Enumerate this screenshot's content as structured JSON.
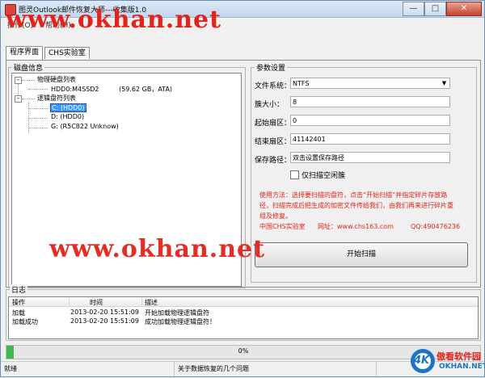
{
  "window": {
    "title": "图灵Outlook邮件恢复大师---收集版1.0"
  },
  "menubar": {
    "items": [
      "操作(O)",
      "帮助(H)"
    ]
  },
  "watermark": {
    "site": "www.okhan.net"
  },
  "tabs": [
    {
      "label": "程序界面",
      "active": true
    },
    {
      "label": "CHS实验室",
      "active": false
    }
  ],
  "disk_info": {
    "group_label": "磁盘信息",
    "physical_root": "物理硬盘列表",
    "physical_disk": {
      "name": "HDD0:M4SSD2",
      "detail": "(59.62 GB，ATA)"
    },
    "logical_root": "逻辑盘符列表",
    "logical_drives": [
      "C: (HDD0)",
      "D: (HDD0)",
      "G: (R5C822 Unknow)"
    ]
  },
  "params": {
    "group_label": "参数设置",
    "filesystem_label": "文件系统：",
    "filesystem_value": "NTFS",
    "cluster_label": "簇大小：",
    "cluster_value": "8",
    "start_label": "起始扇区：",
    "start_value": "0",
    "end_label": "结束扇区：",
    "end_value": "41142401",
    "save_label": "保存路径：",
    "save_value": "双击设置保存路径",
    "scan_free_label": "仅扫描空闲簇",
    "usage_line1": "使用方法：选择要扫描的盘符，点击“开始扫描”并指定碎片存放路",
    "usage_line2": "径，扫描完成后把生成的加密文件传给我们，由我们再来进行碎片重",
    "usage_line3": "组及修复。",
    "lab_name": "中国CHS实验室",
    "website": "网址：www.chs163.com",
    "qq": "QQ:490476236",
    "start_button": "开始扫描"
  },
  "log": {
    "group_label": "日志",
    "columns": [
      "操作",
      "时间",
      "描述"
    ],
    "rows": [
      {
        "op": "加载",
        "time": "2013-02-20 15:51:09",
        "desc": "开始加载物理逻辑盘符"
      },
      {
        "op": "加载成功",
        "time": "2013-02-20 15:51:09",
        "desc": "成功加载物理逻辑盘符！"
      }
    ]
  },
  "progress": {
    "text": "0%",
    "value": 0
  },
  "status": {
    "state": "就绪",
    "link": "关于数据恢复的几个问题"
  },
  "logo": {
    "badge": "4K",
    "brand": "傲看软件园",
    "url": "OKHAN.NET"
  },
  "colors": {
    "accent_red": "#e2231a",
    "selection": "#3399ff",
    "progress_green": "#3fb94b"
  }
}
